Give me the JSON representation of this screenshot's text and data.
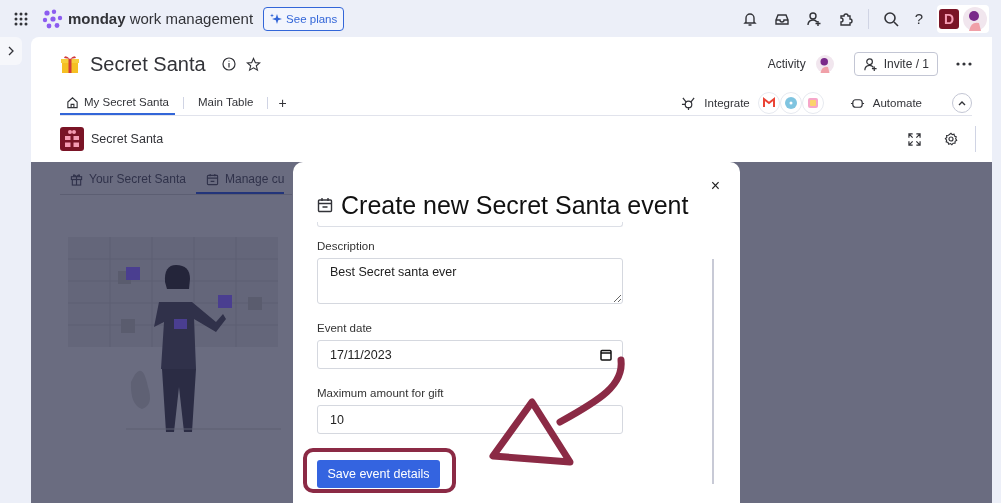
{
  "topbar": {
    "brand_bold": "monday",
    "brand_rest": "work management",
    "see_plans": "See plans",
    "help": "?",
    "account_letter": "D"
  },
  "board": {
    "title": "Secret Santa",
    "activity": "Activity",
    "invite": "Invite / 1",
    "add_tab": "+",
    "integrate": "Integrate",
    "automate": "Automate",
    "tabs": [
      {
        "label": "My Secret Santa",
        "selected": true
      },
      {
        "label": "Main Table",
        "selected": false
      }
    ]
  },
  "widget": {
    "title": "Secret Santa",
    "tabs": [
      {
        "label": "Your Secret Santa",
        "selected": false
      },
      {
        "label": "Manage cu",
        "selected": true
      }
    ]
  },
  "dialog": {
    "title": "Create new Secret Santa event",
    "close": "×",
    "button": "Save event details",
    "fields": [
      {
        "label": "Description",
        "kind": "textarea",
        "value": "Best Secret santa ever"
      },
      {
        "label": "Event date",
        "kind": "date",
        "value": "17/11/2023"
      },
      {
        "label": "Maximum amount for gift",
        "kind": "text",
        "value": "10"
      }
    ]
  }
}
